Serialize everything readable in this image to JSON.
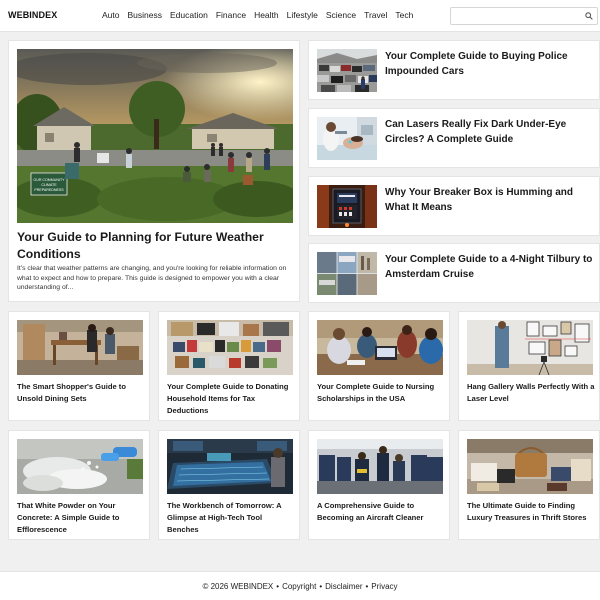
{
  "header": {
    "logo": "WEBINDEX",
    "nav": [
      "Auto",
      "Business",
      "Education",
      "Finance",
      "Health",
      "Lifestyle",
      "Science",
      "Travel",
      "Tech"
    ],
    "search": {
      "placeholder": "",
      "value": ""
    },
    "search_icon": "search-icon"
  },
  "featured": {
    "title": "Your Guide to Planning for Future Weather Conditions",
    "excerpt": "It's clear that weather patterns are changing, and you're looking for reliable information on what to expect and how to prepare. This guide is designed to empower you with a clear understanding of...",
    "image_sign": "OUR COMMUNITY CLIMATE PREPAREDNESS"
  },
  "side_articles": [
    {
      "title": "Your Complete Guide to Buying Police Impounded Cars"
    },
    {
      "title": "Can Lasers Really Fix Dark Under-Eye Circles? A Complete Guide"
    },
    {
      "title": "Why Your Breaker Box is Humming and What It Means"
    },
    {
      "title": "Your Complete Guide to a 4-Night Tilbury to Amsterdam Cruise"
    }
  ],
  "grid_row_1": [
    {
      "title": "The Smart Shopper's Guide to Unsold Dining Sets"
    },
    {
      "title": "Your Complete Guide to Donating Household Items for Tax Deductions"
    },
    {
      "title": "Your Complete Guide to Nursing Scholarships in the USA"
    },
    {
      "title": "Hang Gallery Walls Perfectly With a Laser Level"
    }
  ],
  "grid_row_2": [
    {
      "title": "That White Powder on Your Concrete: A Simple Guide to Efflorescence"
    },
    {
      "title": "The Workbench of Tomorrow: A Glimpse at High-Tech Tool Benches"
    },
    {
      "title": "A Comprehensive Guide to Becoming an Aircraft Cleaner"
    },
    {
      "title": "The Ultimate Guide to Finding Luxury Treasures in Thrift Stores"
    }
  ],
  "footer": {
    "copyright": "© 2026 WEBINDEX",
    "links": [
      "Copyright",
      "Disclaimer",
      "Privacy"
    ]
  }
}
